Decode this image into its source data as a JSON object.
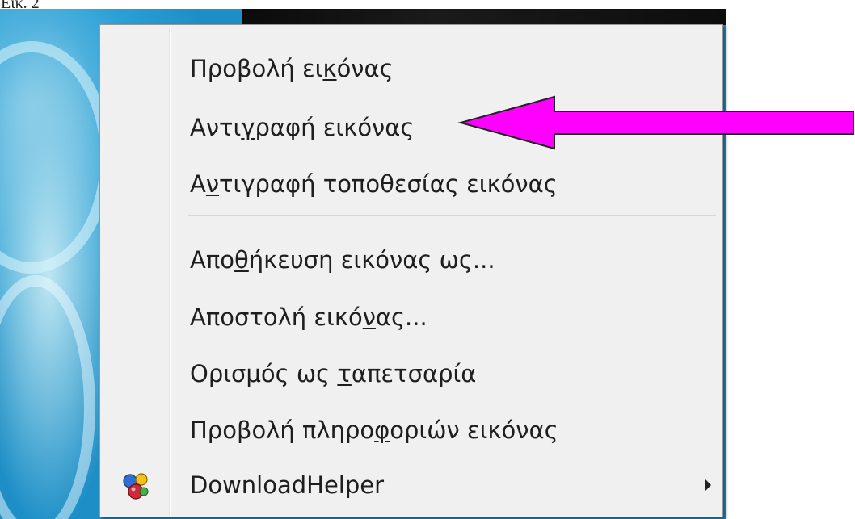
{
  "caption": "Εικ. 2",
  "menu": {
    "items": [
      {
        "before": "Προβολή ει",
        "key": "κ",
        "after": "όνας"
      },
      {
        "before": "Αντι",
        "key": "γ",
        "after": "ραφή εικόνας"
      },
      {
        "before": "Α",
        "key": "ν",
        "after": "τιγραφή τοποθεσίας εικόνας"
      },
      {
        "before": "Απο",
        "key": "θ",
        "after": "ήκευση εικόνας ως..."
      },
      {
        "before": "Αποστολή εικό",
        "key": "ν",
        "after": "ας..."
      },
      {
        "before": "Ορισμός ως ",
        "key": "τ",
        "after": "απετσαρία"
      },
      {
        "before": "Προβολή πληρο",
        "key": "φ",
        "after": "οριών εικόνας"
      },
      {
        "before": "DownloadHelper",
        "key": "",
        "after": ""
      }
    ]
  },
  "annotation": {
    "arrow_color": "#ff00ff",
    "points_to": "Αντιγραφή εικόνας"
  },
  "icons": {
    "downloadhelper": "downloadhelper-icon",
    "submenu": "submenu-arrow-icon"
  }
}
